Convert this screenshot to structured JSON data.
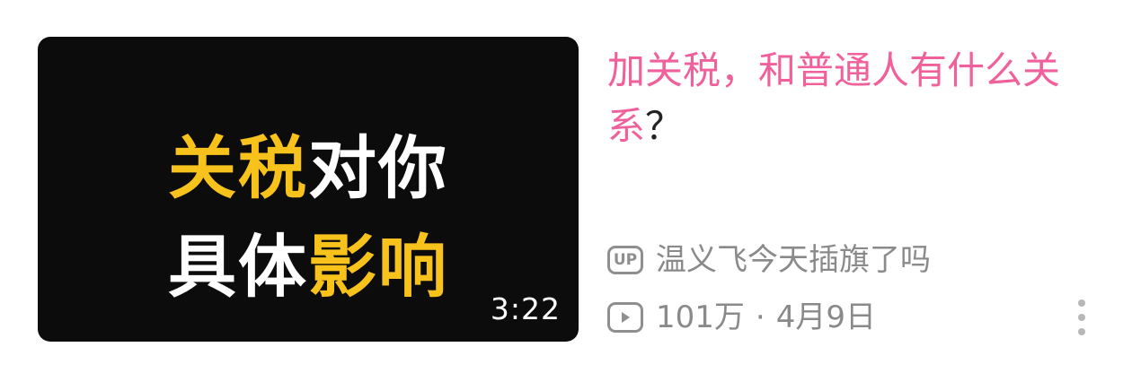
{
  "thumbnail": {
    "line1_highlight": "关税",
    "line1_rest": "对你",
    "line2_rest": "具体",
    "line2_highlight": "影响",
    "duration": "3:22"
  },
  "video": {
    "title_pink": "加关税，和普通人有什么关系",
    "title_rest": "？",
    "author_badge": "UP",
    "author": "温义飞今天插旗了吗",
    "views": "101万",
    "separator": "·",
    "date": "4月9日"
  },
  "icons": {
    "author_badge_icon": "up-badge-icon",
    "views_icon": "play-icon",
    "more_icon": "more-vertical-icon"
  },
  "colors": {
    "title_accent": "#f0609a",
    "thumbnail_highlight": "#f6c21b",
    "meta_text": "#8a8a8a"
  }
}
